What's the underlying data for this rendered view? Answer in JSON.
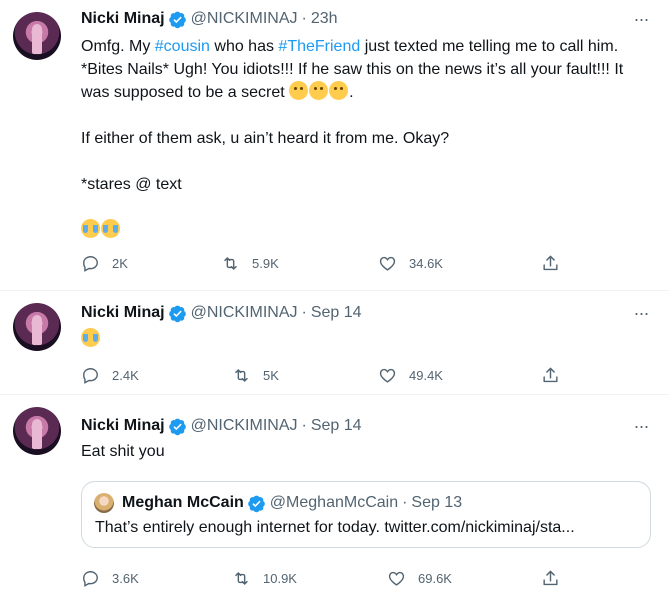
{
  "colors": {
    "accent": "#1d9bf0",
    "muted": "#536471",
    "text": "#0f1419"
  },
  "tweets": [
    {
      "name": "Nicki Minaj",
      "handle": "@NICKIMINAJ",
      "separator": "·",
      "time": "23h",
      "more": "···",
      "body": {
        "line1_a": "Omfg. My ",
        "line1_hashtag1": "#cousin",
        "line1_b": " who has ",
        "line1_hashtag2": "#TheFriend",
        "line1_c": " just texted me telling me to call him. *Bites Nails* Ugh! You idiots!!! If he saw this on the news it’s all your fault!!! It was supposed to be a secret ",
        "line1_end": ".",
        "para2": "If either of them ask, u ain’t heard it from me. Okay?",
        "para3": "*stares @ text"
      },
      "emojis": [
        "zipper-mouth-face",
        "pleading-face",
        "tired-face",
        "loudly-crying-face",
        "face-with-tears-of-joy"
      ],
      "replies": "2K",
      "retweets": "5.9K",
      "likes": "34.6K"
    },
    {
      "name": "Nicki Minaj",
      "handle": "@NICKIMINAJ",
      "separator": "·",
      "time": "Sep 14",
      "more": "···",
      "emojis": [
        "face-with-tears-of-joy"
      ],
      "replies": "2.4K",
      "retweets": "5K",
      "likes": "49.4K"
    },
    {
      "name": "Nicki Minaj",
      "handle": "@NICKIMINAJ",
      "separator": "·",
      "time": "Sep 14",
      "more": "···",
      "body_text": "Eat shit you",
      "quote": {
        "name": "Meghan McCain",
        "handle": "@MeghanMcCain",
        "separator": "·",
        "time": "Sep 13",
        "text": "That’s entirely enough internet for today. twitter.com/nickiminaj/sta..."
      },
      "replies": "3.6K",
      "retweets": "10.9K",
      "likes": "69.6K"
    }
  ]
}
